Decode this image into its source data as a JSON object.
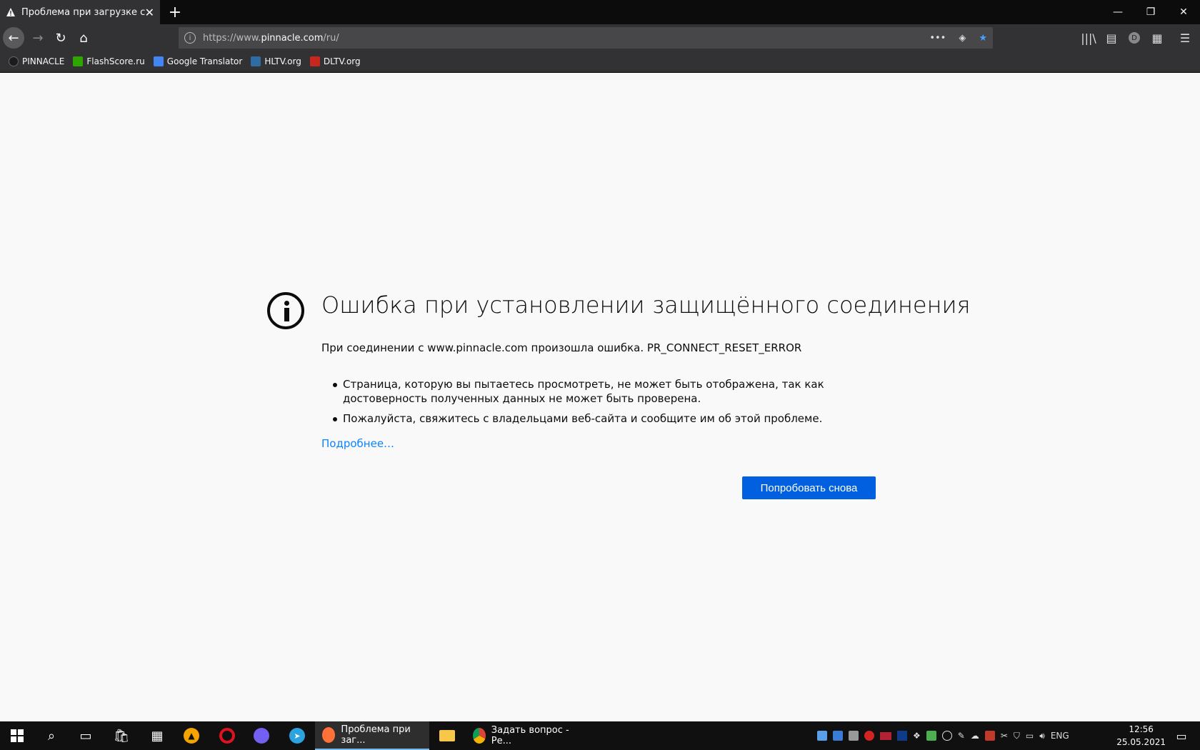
{
  "tab": {
    "title": "Проблема при загрузке страницы",
    "close": "✕",
    "new": "+"
  },
  "window": {
    "minimize": "—",
    "restore": "❐",
    "close": "✕"
  },
  "nav": {
    "back": "←",
    "forward": "→",
    "reload": "↻",
    "home": "⌂",
    "url_gray_prefix": "https://www.",
    "url_domain": "pinnacle.com",
    "url_gray_suffix": "/ru/",
    "page_actions": "•••",
    "pocket": "◈",
    "bookmark_star": "★"
  },
  "toolbar_right": {
    "library": "|||\\",
    "sidebar": "▤",
    "account_initial": "D",
    "ext": "▦",
    "menu": "☰"
  },
  "bookmarks": [
    {
      "label": "PINNACLE",
      "color": "#1b1b1b",
      "icon": "pinnacle-icon"
    },
    {
      "label": "FlashScore.ru",
      "color": "#2fa600",
      "icon": "flashscore-icon"
    },
    {
      "label": "Google Translator",
      "color": "#4285f4",
      "icon": "google-translate-icon"
    },
    {
      "label": "HLTV.org",
      "color": "#2d6da3",
      "icon": "hltv-icon"
    },
    {
      "label": "DLTV.org",
      "color": "#c8271d",
      "icon": "dltv-icon"
    }
  ],
  "error": {
    "title": "Ошибка при установлении защищённого соединения",
    "description": "При соединении с www.pinnacle.com произошла ошибка. PR_CONNECT_RESET_ERROR",
    "bullets": [
      "Страница, которую вы пытаетесь просмотреть, не может быть отображена, так как достоверность полученных данных не может быть проверена.",
      "Пожалуйста, свяжитесь с владельцами веб-сайта и сообщите им об этой проблеме."
    ],
    "learn_more": "Подробнее…",
    "try_again": "Попробовать снова"
  },
  "taskbar": {
    "firefox_label": "Проблема при заг...",
    "chrome_label": "Задать вопрос - Ре...",
    "language": "ENG",
    "time": "12:56",
    "date": "25.05.2021"
  },
  "colors": {
    "accent": "#0060df",
    "link": "#0a84ff",
    "chrome_dark": "#323234"
  }
}
